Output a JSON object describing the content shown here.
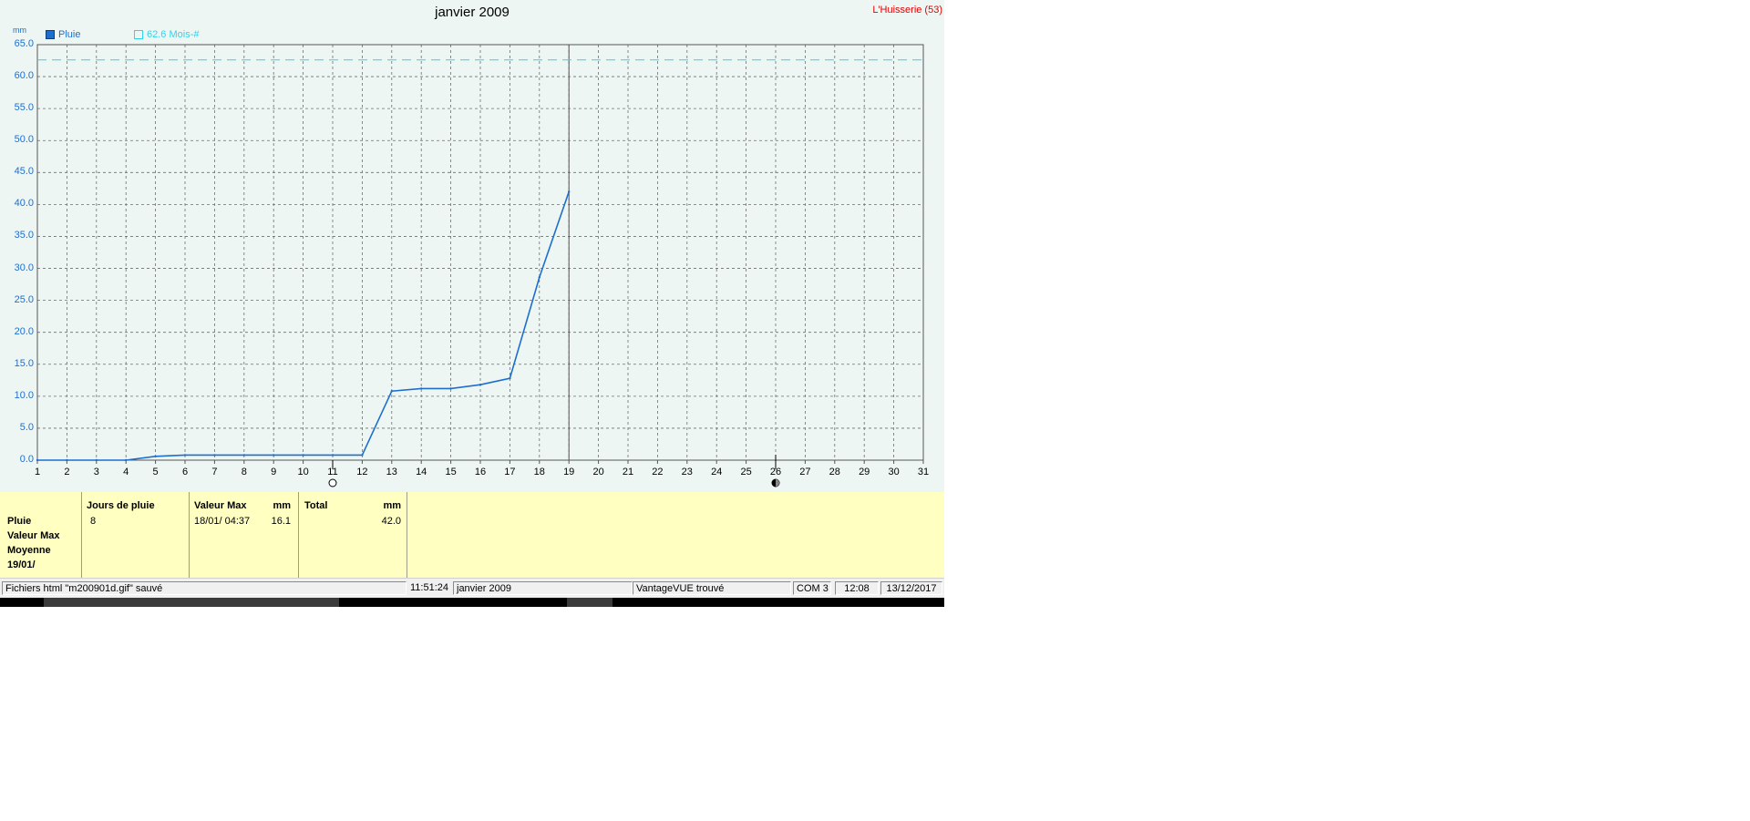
{
  "chart_data": {
    "type": "line",
    "title": "janvier 2009",
    "ylabel": "mm",
    "ylim": [
      0,
      65
    ],
    "ytick_step": 5,
    "xlim": [
      1,
      31
    ],
    "x_ticks": [
      1,
      2,
      3,
      4,
      5,
      6,
      7,
      8,
      9,
      10,
      11,
      12,
      13,
      14,
      15,
      16,
      17,
      18,
      19,
      20,
      21,
      22,
      23,
      24,
      25,
      26,
      27,
      28,
      29,
      30,
      31
    ],
    "y_ticks": [
      "0.0",
      "5.0",
      "10.0",
      "15.0",
      "20.0",
      "25.0",
      "30.0",
      "35.0",
      "40.0",
      "45.0",
      "50.0",
      "55.0",
      "60.0",
      "65.0"
    ],
    "grid": true,
    "legend_placement": "top-left",
    "current_day": 19,
    "new_moon_day": 11,
    "full_moon_day": 26,
    "series": [
      {
        "name": "Pluie",
        "color": "#1c6fcf",
        "x": [
          1,
          2,
          3,
          4,
          5,
          6,
          7,
          8,
          9,
          10,
          11,
          12,
          13,
          14,
          15,
          16,
          17,
          18,
          19
        ],
        "values": [
          0,
          0,
          0,
          0,
          0.6,
          0.8,
          0.8,
          0.8,
          0.8,
          0.8,
          0.8,
          0.8,
          10.8,
          11.2,
          11.2,
          11.8,
          12.8,
          28.6,
          42.0
        ]
      },
      {
        "name": "62.6 Mois-#",
        "color": "#2fd4ea",
        "style": "dashed",
        "x": [
          1,
          31
        ],
        "values": [
          62.6,
          62.6
        ]
      }
    ]
  },
  "header": {
    "title": "janvier 2009",
    "station": "L'Huisserie (53)",
    "unit": "mm"
  },
  "legend": {
    "rain_label": "Pluie",
    "ref_label": "62.6 Mois-#"
  },
  "stats": {
    "row_labels": [
      "Pluie",
      "Valeur Max",
      "Moyenne",
      "19/01/"
    ],
    "days_header": "Jours de pluie",
    "days_value": "8",
    "max_header": "Valeur Max",
    "max_unit": "mm",
    "max_date": "18/01/  04:37",
    "max_value": "16.1",
    "total_header": "Total",
    "total_unit": "mm",
    "total_value": "42.0"
  },
  "statusbar": {
    "message": "Fichiers html  \"m200901d.gif\"  sauvé",
    "time": "11:51:24",
    "period": "janvier 2009",
    "device": "VantageVUE trouvé",
    "port": "COM 3",
    "clock": "12:08",
    "date": "13/12/2017"
  }
}
